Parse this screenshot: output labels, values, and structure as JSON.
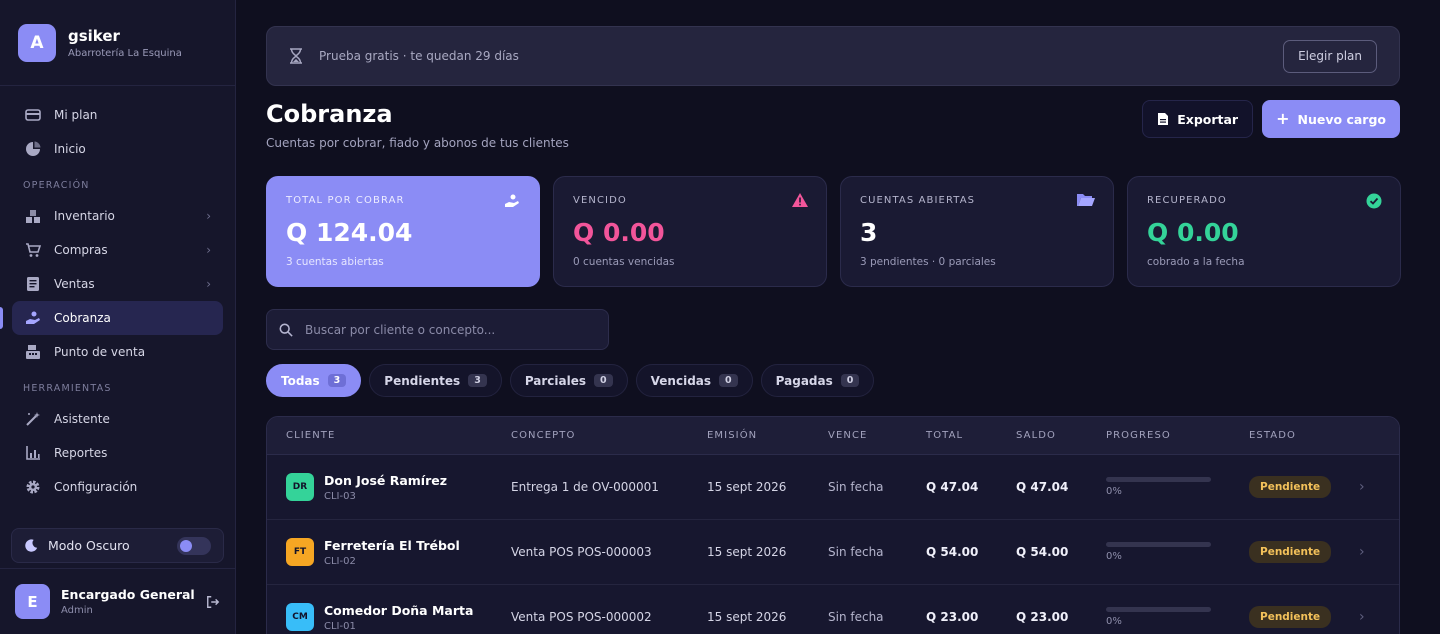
{
  "brand": {
    "initial": "A",
    "name": "gsiker",
    "subtitle": "Abarrotería La Esquina"
  },
  "nav": {
    "top": [
      {
        "label": "Mi plan",
        "icon": "card-icon"
      },
      {
        "label": "Inicio",
        "icon": "pie-chart-icon"
      }
    ],
    "operacion_title": "OPERACIÓN",
    "operacion": [
      {
        "label": "Inventario",
        "icon": "boxes-icon"
      },
      {
        "label": "Compras",
        "icon": "cart-icon"
      },
      {
        "label": "Ventas",
        "icon": "list-icon"
      },
      {
        "label": "Cobranza",
        "icon": "hand-coin-icon",
        "active": true
      },
      {
        "label": "Punto de venta",
        "icon": "register-icon"
      }
    ],
    "herramientas_title": "HERRAMIENTAS",
    "herramientas": [
      {
        "label": "Asistente",
        "icon": "magic-wand-icon"
      },
      {
        "label": "Reportes",
        "icon": "bar-chart-icon"
      },
      {
        "label": "Configuración",
        "icon": "gear-icon"
      }
    ]
  },
  "dark_mode": {
    "label": "Modo Oscuro"
  },
  "user": {
    "initial": "E",
    "name": "Encargado General",
    "role": "Admin"
  },
  "trial": {
    "text": "Prueba gratis · te quedan 29 días",
    "button": "Elegir plan"
  },
  "page": {
    "title": "Cobranza",
    "subtitle": "Cuentas por cobrar, fiado y abonos de tus clientes"
  },
  "actions": {
    "export": "Exportar",
    "new": "Nuevo cargo"
  },
  "stats": [
    {
      "label": "TOTAL POR COBRAR",
      "value": "Q 124.04",
      "hint": "3 cuentas abiertas",
      "color": "#ffffff"
    },
    {
      "label": "VENCIDO",
      "value": "Q 0.00",
      "hint": "0 cuentas vencidas",
      "color": "#f2559a"
    },
    {
      "label": "CUENTAS ABIERTAS",
      "value": "3",
      "hint": "3 pendientes · 0 parciales",
      "color": "#ffffff"
    },
    {
      "label": "RECUPERADO",
      "value": "Q 0.00",
      "hint": "cobrado a la fecha",
      "color": "#34d399"
    }
  ],
  "search": {
    "placeholder": "Buscar por cliente o concepto..."
  },
  "filters": [
    {
      "label": "Todas",
      "count": "3"
    },
    {
      "label": "Pendientes",
      "count": "3"
    },
    {
      "label": "Parciales",
      "count": "0"
    },
    {
      "label": "Vencidas",
      "count": "0"
    },
    {
      "label": "Pagadas",
      "count": "0"
    }
  ],
  "table": {
    "headers": [
      "CLIENTE",
      "CONCEPTO",
      "EMISIÓN",
      "VENCE",
      "TOTAL",
      "SALDO",
      "PROGRESO",
      "ESTADO"
    ],
    "rows": [
      {
        "initials": "DR",
        "avatar_color": "#34d399",
        "name": "Don José Ramírez",
        "code": "CLI-03",
        "concept": "Entrega 1 de OV-000001",
        "emision": "15 sept 2026",
        "vence": "Sin fecha",
        "total": "Q 47.04",
        "saldo": "Q 47.04",
        "progress": 0,
        "progress_text": "0%",
        "estado": "Pendiente"
      },
      {
        "initials": "FT",
        "avatar_color": "#f6a623",
        "name": "Ferretería El Trébol",
        "code": "CLI-02",
        "concept": "Venta POS POS-000003",
        "emision": "15 sept 2026",
        "vence": "Sin fecha",
        "total": "Q 54.00",
        "saldo": "Q 54.00",
        "progress": 0,
        "progress_text": "0%",
        "estado": "Pendiente"
      },
      {
        "initials": "CM",
        "avatar_color": "#38bdf8",
        "name": "Comedor Doña Marta",
        "code": "CLI-01",
        "concept": "Venta POS POS-000002",
        "emision": "15 sept 2026",
        "vence": "Sin fecha",
        "total": "Q 23.00",
        "saldo": "Q 23.00",
        "progress": 0,
        "progress_text": "0%",
        "estado": "Pendiente"
      }
    ]
  }
}
